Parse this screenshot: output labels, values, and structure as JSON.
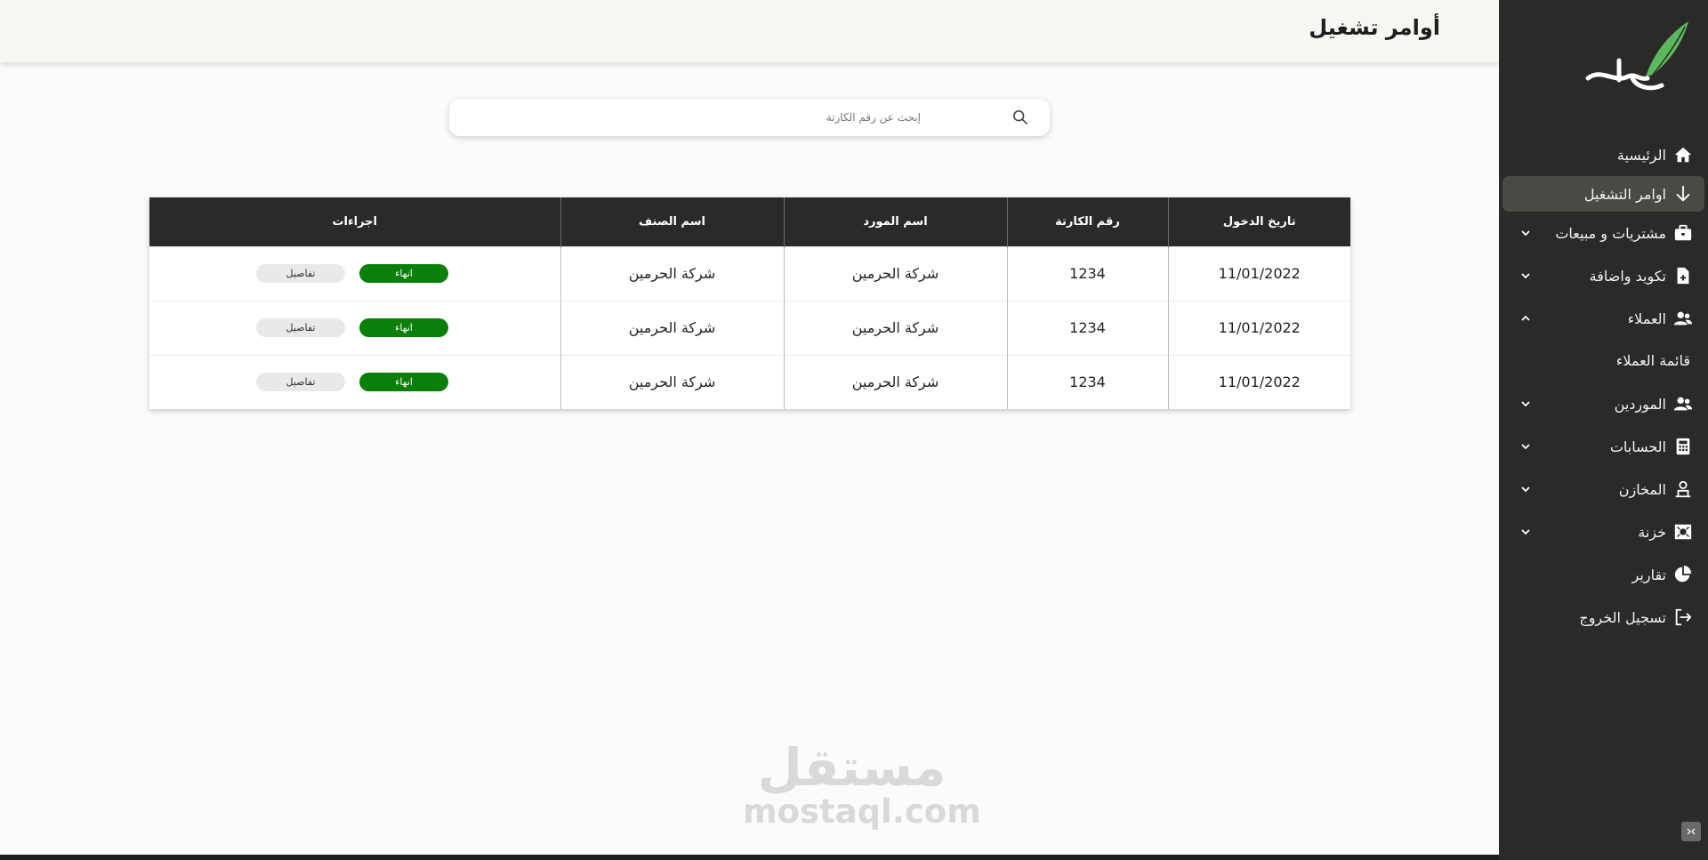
{
  "header": {
    "title": "أوامر تشغيل"
  },
  "search": {
    "placeholder": "إبحث عن رقم الكارتة"
  },
  "sidebar": {
    "items": [
      {
        "label": "الرئيسية",
        "icon": "home-icon"
      },
      {
        "label": "اوامر التشغيل",
        "icon": "arrow-down-icon",
        "active": true
      },
      {
        "label": "مشتريات و مبيعات",
        "icon": "briefcase-icon"
      },
      {
        "label": "تكويد واضافة",
        "icon": "file-plus-icon"
      },
      {
        "label": "العملاء",
        "icon": "users-icon"
      },
      {
        "label": "الموردين",
        "icon": "users-icon"
      },
      {
        "label": "الحسابات",
        "icon": "calculator-icon"
      },
      {
        "label": "المخازن",
        "icon": "warehouse-icon"
      },
      {
        "label": "خزنة",
        "icon": "cash-icon"
      },
      {
        "label": "تقارير",
        "icon": "pie-chart-icon"
      },
      {
        "label": "تسجيل الخروج",
        "icon": "logout-icon"
      }
    ],
    "subitems": {
      "clients_list": "قائمة العملاء"
    }
  },
  "table": {
    "headers": [
      "تاريخ الدخول",
      "رقم الكارتة",
      "اسم المورد",
      "اسم الصنف",
      "اجراءات"
    ],
    "rows": [
      {
        "date": "11/01/2022",
        "card": "1234",
        "supplier": "شركة الحرمين",
        "item": "شركة الحرمين"
      },
      {
        "date": "11/01/2022",
        "card": "1234",
        "supplier": "شركة الحرمين",
        "item": "شركة الحرمين"
      },
      {
        "date": "11/01/2022",
        "card": "1234",
        "supplier": "شركة الحرمين",
        "item": "شركة الحرمين"
      }
    ],
    "actions": {
      "end_label": "انهاء",
      "details_label": "تفاصيل"
    }
  },
  "watermark": {
    "arabic": "مستقل",
    "english": "mostaql.com"
  },
  "colors": {
    "sidebar": "#2b2a28",
    "accent_green": "#0a7f0a",
    "header_bg": "#f6f6f3"
  }
}
